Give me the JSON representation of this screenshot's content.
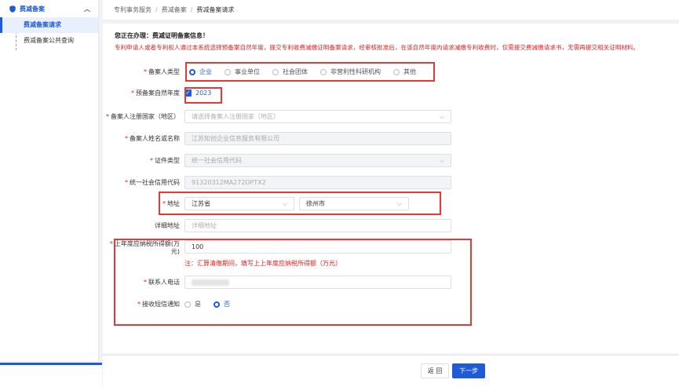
{
  "sidebar": {
    "group_label": "费减备案",
    "items": [
      {
        "label": "费减备案请求"
      },
      {
        "label": "费减备案公共查询"
      }
    ]
  },
  "breadcrumb": [
    "专利事务服务",
    "费减备案",
    "费减备案请求"
  ],
  "notice": {
    "title": "您正在办理：费减证明备案信息！",
    "text": "专利申请人或者专利权人通过本系统选择预备案自然年度，提交专利收费减缴证明备案请求，经审核批准后，在该自然年度内请求减缴专利收费时，仅需提交费减缴请求书，无需再提交相关证明材料。"
  },
  "form": {
    "filer_type": {
      "label": "备案人类型",
      "options": [
        "企业",
        "事业单位",
        "社会团体",
        "非营利性科研机构",
        "其他"
      ],
      "selected": "企业"
    },
    "year": {
      "label": "预备案自然年度",
      "value": "2023"
    },
    "country": {
      "label": "备案人注册国家（地区）",
      "placeholder": "请选择备案人注册国家（地区）"
    },
    "name": {
      "label": "备案人姓名或名称",
      "value": "江苏知创企业信息服务有限公司"
    },
    "id_type": {
      "label": "证件类型",
      "value": "统一社会信用代码"
    },
    "credit_code": {
      "label": "统一社会信用代码",
      "value": "91320312MA272DPTX2"
    },
    "address": {
      "label": "地址",
      "province": "江苏省",
      "city": "徐州市"
    },
    "detail_address": {
      "label": "详细地址",
      "placeholder": "详细地址"
    },
    "tax": {
      "label_line1": "上年度应纳税所得额(万",
      "label_line2": "元)",
      "value": "100",
      "hint": "注：汇算清缴期间，填写上上年度应纳税所得额（万元）"
    },
    "phone": {
      "label": "联系人电话"
    },
    "sms": {
      "label": "接收短信通知",
      "options": [
        "是",
        "否"
      ],
      "selected": "否"
    }
  },
  "buttons": {
    "back": "返 回",
    "next": "下一步"
  },
  "colors": {
    "primary": "#1e5bd6",
    "alert": "#e02020",
    "annotation_box": "#e53935"
  }
}
